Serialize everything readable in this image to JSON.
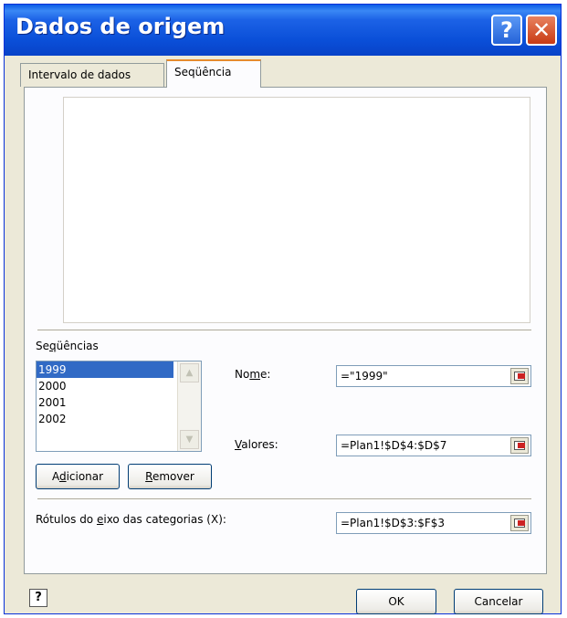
{
  "window": {
    "title": "Dados de origem",
    "help_glyph": "?",
    "close_glyph": "✕"
  },
  "tabs": [
    {
      "label": "Intervalo de dados"
    },
    {
      "label": "Seqüência"
    }
  ],
  "series_list": {
    "label_prefix": "Se",
    "label_mnemonic": "q",
    "label_rest": "üências",
    "items": [
      "1999",
      "2000",
      "2001",
      "2002"
    ],
    "selected": "1999"
  },
  "buttons": {
    "add_prefix": "A",
    "add_mnemonic": "d",
    "add_rest": "icionar",
    "remove_mnemonic": "R",
    "remove_rest": "emover",
    "ok": "OK",
    "cancel": "Cancelar"
  },
  "fields": {
    "nome_prefix": "No",
    "nome_mnemonic": "m",
    "nome_rest": "e:",
    "nome_value": "=\"1999\"",
    "valores_mnemonic": "V",
    "valores_rest": "alores:",
    "valores_value": "=Plan1!$D$4:$D$7",
    "rotulos_prefix": "Rótulos do ",
    "rotulos_mnemonic": "e",
    "rotulos_rest": "ixo das categorias (X):",
    "rotulos_value": "=Plan1!$D$3:$F$3"
  },
  "icons": {
    "scroll_up": "▲",
    "scroll_down": "▼",
    "help_corner": "?"
  },
  "colors": {
    "title_bar": "#0a4fd8",
    "selection": "#316ac5",
    "dialog_bg": "#ece9d8",
    "tab_accent": "#e68b2c"
  }
}
